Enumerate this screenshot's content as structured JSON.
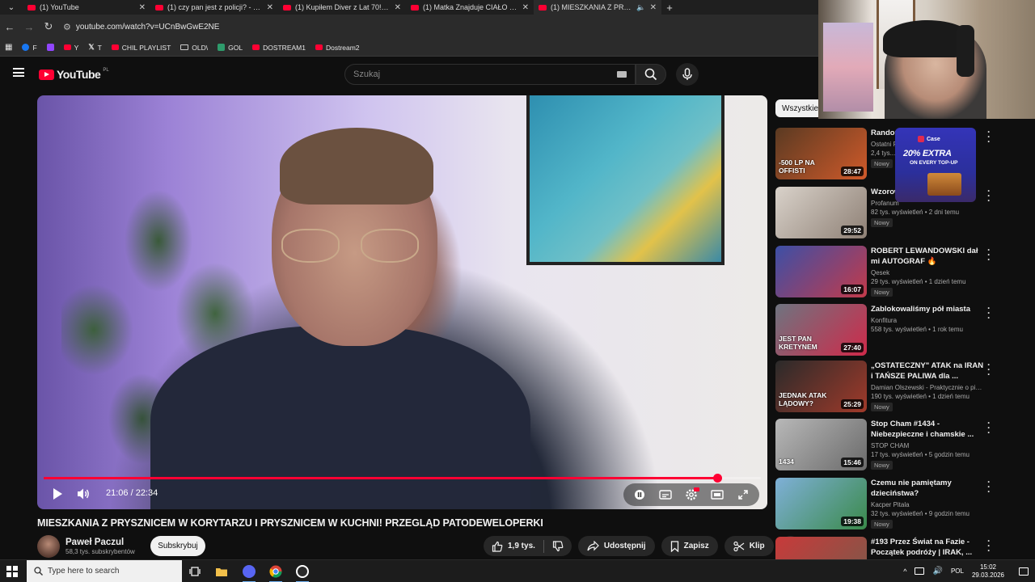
{
  "browser": {
    "tabs": [
      {
        "title": "(1) YouTube",
        "active": false
      },
      {
        "title": "(1) czy pan jest z policji? - YouT",
        "active": false
      },
      {
        "title": "(1) Kupiłem Diver z Lat 70! Cas",
        "active": false
      },
      {
        "title": "(1) Matka Znajduje CIAŁO Swoj",
        "active": false
      },
      {
        "title": "(1) MIESZKANIA Z PRYSZNI",
        "active": true
      }
    ],
    "url": "youtube.com/watch?v=UCnBwGwE2NE",
    "bookmarks": [
      {
        "label": "F",
        "color": "#1877f2"
      },
      {
        "label": "",
        "color": "#9146ff"
      },
      {
        "label": "Y",
        "color": "#ff0033"
      },
      {
        "label": "T",
        "color": "#ffffff"
      },
      {
        "label": "CHIL PLAYLIST",
        "color": "#ff0033"
      },
      {
        "label": "OLD\\",
        "color": ""
      },
      {
        "label": "GOL",
        "color": "#2e9b6b"
      },
      {
        "label": "DOSTREAM1",
        "color": "#ff0033"
      },
      {
        "label": "Dostream2",
        "color": "#ff0033"
      }
    ]
  },
  "youtube": {
    "logo_text": "YouTube",
    "country_code": "PL",
    "search_placeholder": "Szukaj"
  },
  "player": {
    "time": "21:06 / 22:34",
    "progress_fraction": 0.9395
  },
  "video": {
    "title": "MIESZKANIA Z PRYSZNICEM W KORYTARZU I PRYSZNICEM W KUCHNI! PRZEGLĄD PATODEWELOPERKI",
    "channel_name": "Paweł Paczul",
    "subscribers": "58,3 tys. subskrybentów",
    "subscribe_label": "Subskrybuj",
    "likes": "1,9 tys.",
    "share_label": "Udostępnij",
    "save_label": "Zapisz",
    "clip_label": "Klip"
  },
  "sidebar": {
    "chip": "Wszystkie",
    "items": [
      {
        "title": "Random... minuto...",
        "channel": "Ostatni F...",
        "stats": "2,4 tys...",
        "badge": "Nowy",
        "duration": "28:47",
        "thumb_text": "-500 LP NA OFFISTI",
        "thumb_colors": [
          "#5a3a22",
          "#d05a2a"
        ]
      },
      {
        "title": "Wzorow... Odciął ojcu gło...",
        "channel": "Profanum",
        "stats": "82 tys. wyświetleń • 2 dni temu",
        "badge": "Nowy",
        "duration": "29:52",
        "thumb_text": "",
        "thumb_colors": [
          "#d9d2ca",
          "#8e8075"
        ]
      },
      {
        "title": "ROBERT LEWANDOWSKI dał mi AUTOGRAF 🔥",
        "channel": "Qesek",
        "stats": "29 tys. wyświetleń • 1 dzień temu",
        "badge": "Nowy",
        "duration": "16:07",
        "thumb_text": "",
        "thumb_colors": [
          "#3c4fa6",
          "#c33a4a"
        ]
      },
      {
        "title": "Zablokowaliśmy pół miasta",
        "channel": "Konfitura",
        "stats": "558 tys. wyświetleń • 1 rok temu",
        "badge": "",
        "duration": "27:40",
        "thumb_text": "JEST PAN KRETYNEM",
        "thumb_colors": [
          "#6e7480",
          "#cf2a4a"
        ]
      },
      {
        "title": "„OSTATECZNY\" ATAK na IRAN i TAŃSZE PALIWA dla ...",
        "channel": "Damian Olszewski - Praktycznie o pienią...",
        "stats": "190 tys. wyświetleń • 1 dzień temu",
        "badge": "Nowy",
        "duration": "25:29",
        "thumb_text": "JEDNAK ATAK LĄDOWY?",
        "thumb_colors": [
          "#2a2a2a",
          "#a03a2a"
        ]
      },
      {
        "title": "Stop Cham #1434 - Niebezpieczne i chamskie ...",
        "channel": "STOP CHAM",
        "stats": "17 tys. wyświetleń • 5 godzin temu",
        "badge": "Nowy",
        "duration": "15:46",
        "thumb_text": "1434",
        "thumb_colors": [
          "#b8b8b8",
          "#6a6a6a"
        ]
      },
      {
        "title": "Czemu nie pamiętamy dzieciństwa?",
        "channel": "Kacper Pitala",
        "stats": "32 tys. wyświetleń • 9 godzin temu",
        "badge": "Nowy",
        "duration": "19:38",
        "thumb_text": "",
        "thumb_colors": [
          "#7fb0d8",
          "#3a8a4a"
        ]
      },
      {
        "title": "#193 Przez Świat na Fazie - Początek podróży | IRAK, ...",
        "channel": "",
        "stats": "",
        "badge": "",
        "duration": "",
        "thumb_text": "#193",
        "thumb_colors": [
          "#c83a3a",
          "#7a5a4a"
        ]
      }
    ]
  },
  "overlay_ad": {
    "brand": "Case",
    "headline": "20% EXTRA",
    "sub": "ON EVERY TOP-UP"
  },
  "taskbar": {
    "search_placeholder": "Type here to search",
    "language": "POL",
    "time": "15:02",
    "date": "29.03.2026"
  }
}
